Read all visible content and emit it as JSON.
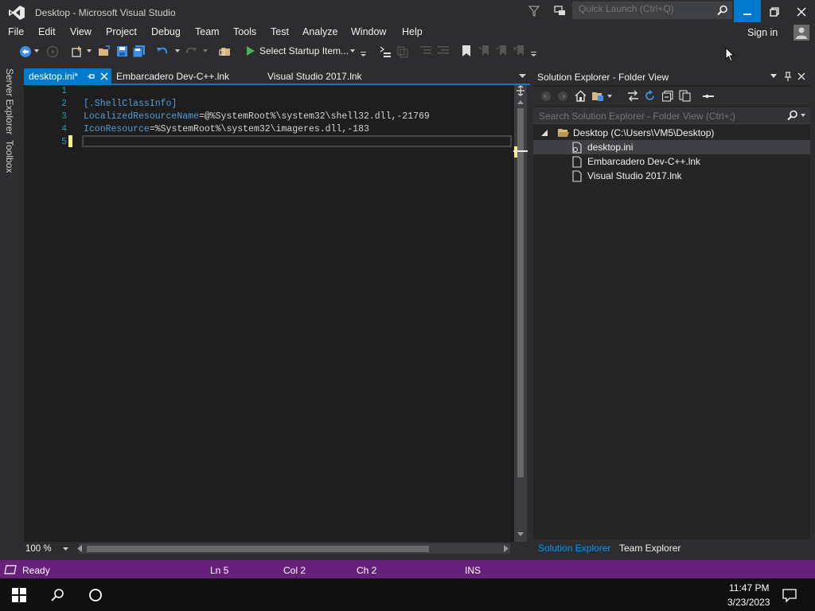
{
  "window": {
    "title": "Desktop - Microsoft Visual Studio",
    "quick_launch_placeholder": "Quick Launch (Ctrl+Q)"
  },
  "menu": {
    "items": [
      "File",
      "Edit",
      "View",
      "Project",
      "Debug",
      "Team",
      "Tools",
      "Test",
      "Analyze",
      "Window",
      "Help"
    ],
    "sign_in": "Sign in"
  },
  "toolbar": {
    "startup_item": "Select Startup Item..."
  },
  "left_tabs": {
    "server_explorer": "Server Explorer",
    "toolbox": "Toolbox"
  },
  "doc_tabs": {
    "active": "desktop.ini*",
    "tab2": "Embarcadero Dev-C++.lnk",
    "tab3": "Visual Studio 2017.lnk"
  },
  "editor": {
    "line_numbers": [
      "1",
      "2",
      "3",
      "4",
      "5"
    ],
    "line2_section": "[.ShellClassInfo]",
    "line3_key": "LocalizedResourceName",
    "line3_eq": "=",
    "line3_value": "@%SystemRoot%\\system32\\shell32.dll,-21769",
    "line4_key": "IconResource",
    "line4_eq": "=",
    "line4_value": "%SystemRoot%\\system32\\imageres.dll,-183",
    "zoom": "100 %"
  },
  "solution_explorer": {
    "title": "Solution Explorer - Folder View",
    "search_placeholder": "Search Solution Explorer - Folder View (Ctrl+;)",
    "root": "Desktop (C:\\Users\\VM5\\Desktop)",
    "files": [
      "desktop.ini",
      "Embarcadero Dev-C++.lnk",
      "Visual Studio 2017.lnk"
    ],
    "tab_solution": "Solution Explorer",
    "tab_team": "Team Explorer"
  },
  "status": {
    "ready": "Ready",
    "ln": "Ln 5",
    "col": "Col 2",
    "ch": "Ch 2",
    "ins": "INS"
  },
  "taskbar": {
    "time": "11:47 PM",
    "date": "3/23/2023"
  },
  "colors": {
    "accent": "#007acc",
    "status_bar": "#68217a",
    "editor_bg": "#1e1e1e"
  }
}
